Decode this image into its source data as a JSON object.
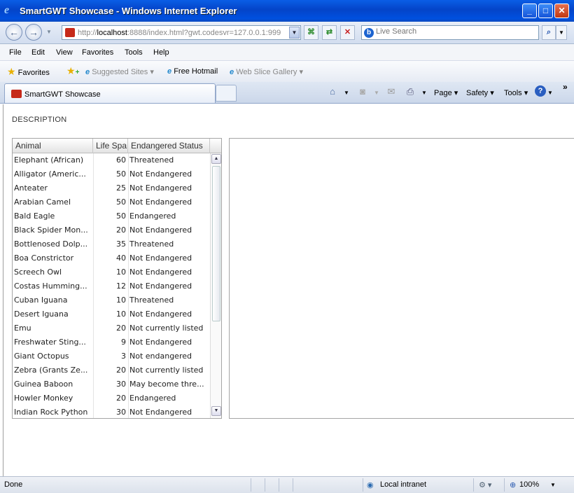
{
  "window": {
    "title": "SmartGWT Showcase - Windows Internet Explorer"
  },
  "address": {
    "url_gray": "http://",
    "url_host": "localhost",
    "url_rest": ":8888/index.html?gwt.codesvr=127.0.0.1:999"
  },
  "search": {
    "placeholder": "Live Search"
  },
  "menu": [
    "File",
    "Edit",
    "View",
    "Favorites",
    "Tools",
    "Help"
  ],
  "favorites": {
    "label": "Favorites",
    "suggested": "Suggested Sites",
    "hotmail": "Free Hotmail",
    "webslice": "Web Slice Gallery"
  },
  "tab": {
    "label": "SmartGWT Showcase"
  },
  "commands": {
    "page": "Page",
    "safety": "Safety",
    "tools": "Tools"
  },
  "page": {
    "description": "DESCRIPTION"
  },
  "grid": {
    "headers": [
      "Animal",
      "Life Spa",
      "Endangered Status"
    ],
    "rows": [
      {
        "animal": "Elephant (African)",
        "life": "60",
        "status": "Threatened"
      },
      {
        "animal": "Alligator (Americ...",
        "life": "50",
        "status": "Not Endangered"
      },
      {
        "animal": "Anteater",
        "life": "25",
        "status": "Not Endangered"
      },
      {
        "animal": "Arabian Camel",
        "life": "50",
        "status": "Not Endangered"
      },
      {
        "animal": "Bald Eagle",
        "life": "50",
        "status": "Endangered"
      },
      {
        "animal": "Black Spider Mon...",
        "life": "20",
        "status": "Not Endangered"
      },
      {
        "animal": "Bottlenosed Dolp...",
        "life": "35",
        "status": "Threatened"
      },
      {
        "animal": "Boa Constrictor",
        "life": "40",
        "status": "Not Endangered"
      },
      {
        "animal": "Screech Owl",
        "life": "10",
        "status": "Not Endangered"
      },
      {
        "animal": "Costas Humming...",
        "life": "12",
        "status": "Not Endangered"
      },
      {
        "animal": "Cuban Iguana",
        "life": "10",
        "status": "Threatened"
      },
      {
        "animal": "Desert Iguana",
        "life": "10",
        "status": "Not Endangered"
      },
      {
        "animal": "Emu",
        "life": "20",
        "status": "Not currently listed"
      },
      {
        "animal": "Freshwater Sting...",
        "life": "9",
        "status": "Not Endangered"
      },
      {
        "animal": "Giant Octopus",
        "life": "3",
        "status": "Not endangered"
      },
      {
        "animal": "Zebra (Grants Ze...",
        "life": "20",
        "status": "Not currently listed"
      },
      {
        "animal": "Guinea Baboon",
        "life": "30",
        "status": "May become thre..."
      },
      {
        "animal": "Howler Monkey",
        "life": "20",
        "status": "Endangered"
      },
      {
        "animal": "Indian Rock Python",
        "life": "30",
        "status": "Not Endangered"
      }
    ]
  },
  "statusbar": {
    "left": "Done",
    "zone": "Local intranet",
    "zoom": "100%"
  }
}
